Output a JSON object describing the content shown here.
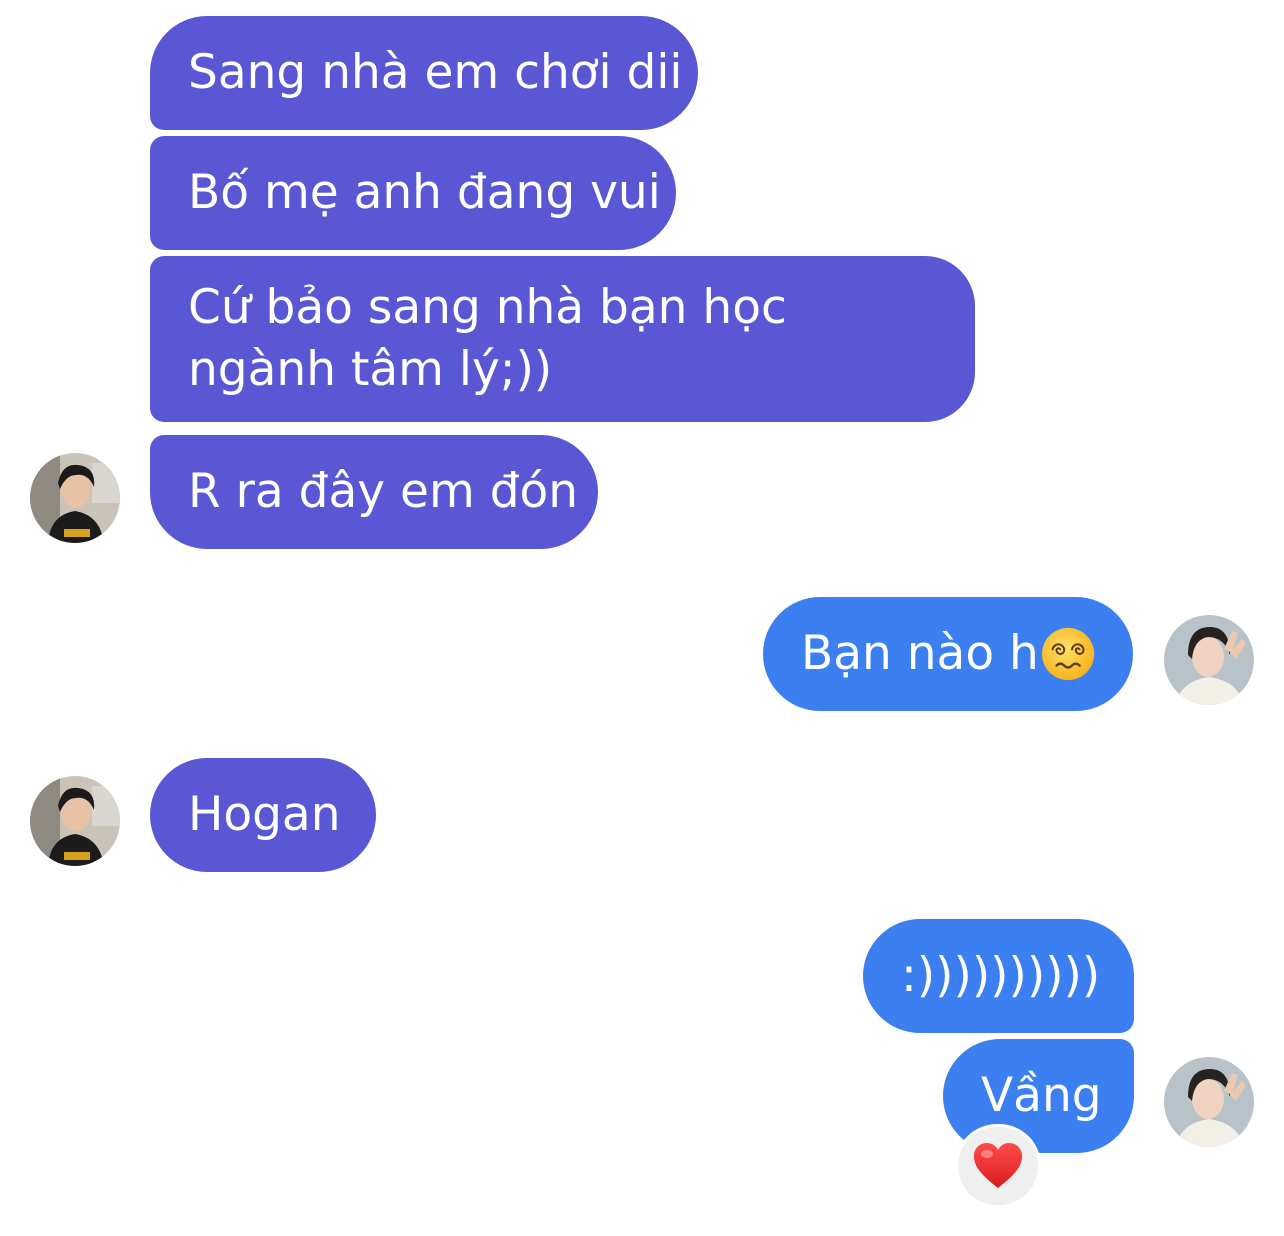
{
  "colors": {
    "incoming_bubble": "#5957d4",
    "outgoing_bubble": "#3b7ff0",
    "reaction_bg": "#efefef"
  },
  "messages": [
    {
      "side": "incoming",
      "text": "Sang nhà em chơi dii"
    },
    {
      "side": "incoming",
      "text": "Bố mẹ anh đang vui"
    },
    {
      "side": "incoming",
      "text": "Cứ bảo sang nhà bạn học ngành tâm lý;))"
    },
    {
      "side": "incoming",
      "text": "R ra đây em đón"
    },
    {
      "side": "outgoing",
      "text": "Bạn nào h",
      "emoji": "dizzy-face-icon"
    },
    {
      "side": "incoming",
      "text": "Hogan"
    },
    {
      "side": "outgoing",
      "text": ":))))))))))"
    },
    {
      "side": "outgoing",
      "text": "Vầng",
      "reaction": "red-heart-icon"
    }
  ]
}
